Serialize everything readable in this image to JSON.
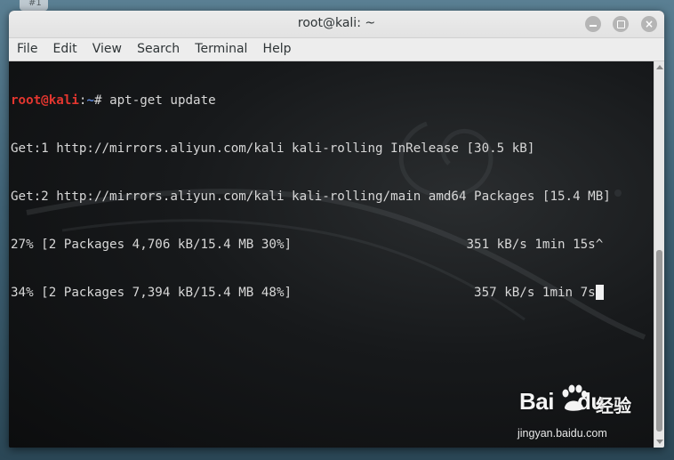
{
  "window": {
    "title": "root@kali: ~"
  },
  "menu": [
    {
      "label": "File"
    },
    {
      "label": "Edit"
    },
    {
      "label": "View"
    },
    {
      "label": "Search"
    },
    {
      "label": "Terminal"
    },
    {
      "label": "Help"
    }
  ],
  "terminal": {
    "prompt": {
      "user": "root",
      "at": "@",
      "host": "kali",
      "sep": ":",
      "path": "~",
      "symbol": "# ",
      "command": "apt-get update"
    },
    "lines": [
      "Get:1 http://mirrors.aliyun.com/kali kali-rolling InRelease [30.5 kB]",
      "Get:2 http://mirrors.aliyun.com/kali kali-rolling/main amd64 Packages [15.4 MB]",
      "27% [2 Packages 4,706 kB/15.4 MB 30%]                       351 kB/s 1min 15s^",
      "34% [2 Packages 7,394 kB/15.4 MB 48%]                        357 kB/s 1min 7s"
    ]
  },
  "watermark": {
    "brand_left": "Bai",
    "brand_right": "du",
    "suffix": "经验",
    "url": "jingyan.baidu.com"
  },
  "colors": {
    "prompt_user": "#e3362f",
    "prompt_path": "#5f87d7",
    "terminal_fg": "#d7d7d7"
  }
}
